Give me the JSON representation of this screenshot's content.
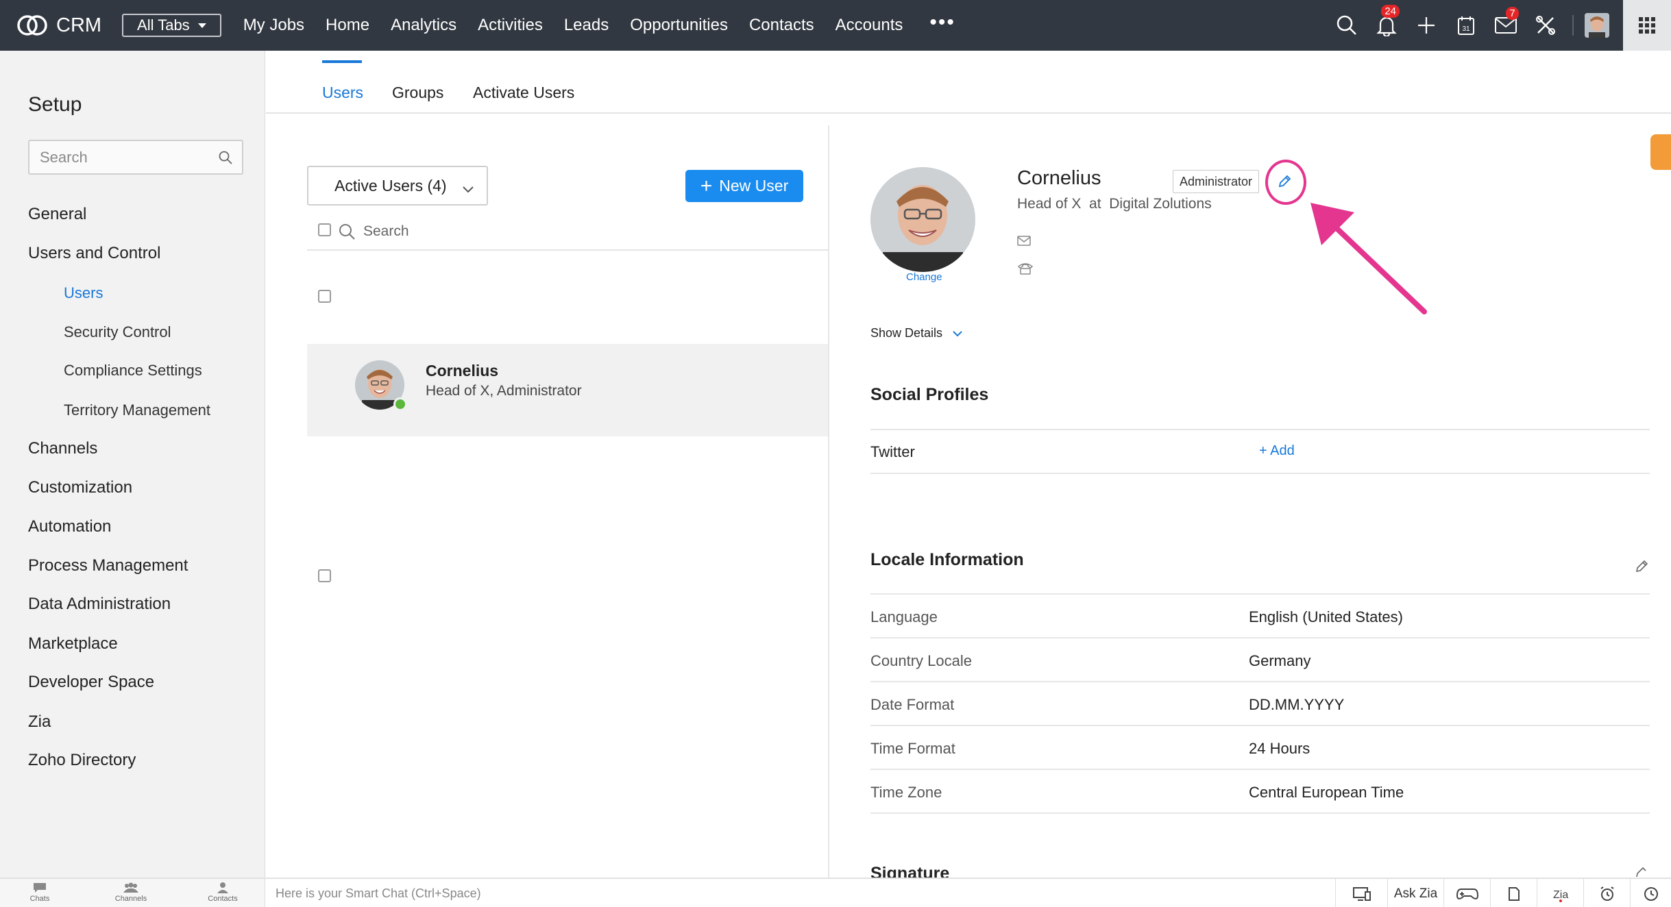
{
  "topbar": {
    "logo_text": "CRM",
    "all_tabs": "All Tabs",
    "nav": [
      "My Jobs",
      "Home",
      "Analytics",
      "Activities",
      "Leads",
      "Opportunities",
      "Contacts",
      "Accounts"
    ],
    "more": "•••",
    "notifications_count": "24",
    "mail_count": "7",
    "colors": {
      "bar": "#323841",
      "badge": "#e42527"
    }
  },
  "sidebar": {
    "title": "Setup",
    "search_placeholder": "Search",
    "sections": [
      "General",
      "Users and Control",
      "Channels",
      "Customization",
      "Automation",
      "Process Management",
      "Data Administration",
      "Marketplace",
      "Developer Space",
      "Zia",
      "Zoho Directory"
    ],
    "subitems": [
      "Users",
      "Security Control",
      "Compliance Settings",
      "Territory Management"
    ],
    "active_subitem": "Users"
  },
  "tabs": {
    "items": [
      "Users",
      "Groups",
      "Activate Users"
    ],
    "active": "Users"
  },
  "user_list": {
    "filter": "Active Users (4)",
    "new_user_label": "New User",
    "search_placeholder": "Search",
    "rows": [
      {
        "name": "Cornelius",
        "subtitle": "Head of X, Administrator",
        "online": true
      }
    ]
  },
  "detail": {
    "name": "Cornelius",
    "role": "Administrator",
    "title_line": "Head of X  at  Digital Zolutions",
    "change_label": "Change",
    "show_details": "Show Details",
    "social": {
      "title": "Social Profiles",
      "rows": [
        {
          "label": "Twitter",
          "action": "+ Add"
        }
      ]
    },
    "locale": {
      "title": "Locale Information",
      "rows": [
        {
          "label": "Language",
          "value": "English (United States)"
        },
        {
          "label": "Country Locale",
          "value": "Germany"
        },
        {
          "label": "Date Format",
          "value": "DD.MM.YYYY"
        },
        {
          "label": "Time Format",
          "value": "24 Hours"
        },
        {
          "label": "Time Zone",
          "value": "Central European Time"
        }
      ]
    },
    "signature_title": "Signature",
    "accent_color": "#1878d8",
    "annotation_color": "#e4358f"
  },
  "bottombar": {
    "left_icons": [
      "Chats",
      "Channels",
      "Contacts"
    ],
    "smart_chat": "Here is your Smart Chat (Ctrl+Space)",
    "ask_zia": "Ask Zia"
  }
}
